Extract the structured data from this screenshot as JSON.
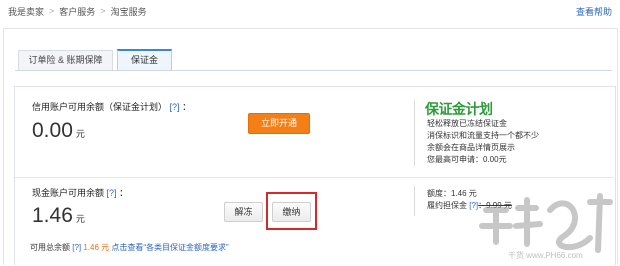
{
  "breadcrumb": [
    "我是卖家",
    "客户服务",
    "淘宝服务"
  ],
  "breadcrumb_sep": ">",
  "help_link": "查看帮助",
  "tabs": [
    "订单险 & 账期保障",
    "保证金"
  ],
  "credit": {
    "label": "信用账户可用余额（保证金计划）",
    "help": "[?]",
    "colon": "：",
    "amount": "0.00",
    "unit": "元",
    "button": "立即开通"
  },
  "plan": {
    "logo": "保证金计划",
    "lines": [
      "轻松释放已冻结保证金",
      "消保标识和流量支持一个都不少",
      "余额会在商品详情页展示",
      "您最高可申请：0.00元"
    ]
  },
  "cash": {
    "label": "现金账户可用余额",
    "help": "[?]",
    "colon": "：",
    "amount": "1.46",
    "unit": "元",
    "unfreeze_button": "解冻",
    "pay_button": "缴纳"
  },
  "quota": {
    "limit": "额度：1.46 元",
    "deposit_prefix": "履约担保金",
    "deposit_help": "[?]",
    "deposit_value": "：9.99 元"
  },
  "footer": {
    "prefix": "可用总余额",
    "help": "[?]",
    "amount": " 1.46 元 ",
    "link": "点击查看“各类目保证金额度要求”"
  },
  "watermark_text": "干货 www.PH66.com"
}
